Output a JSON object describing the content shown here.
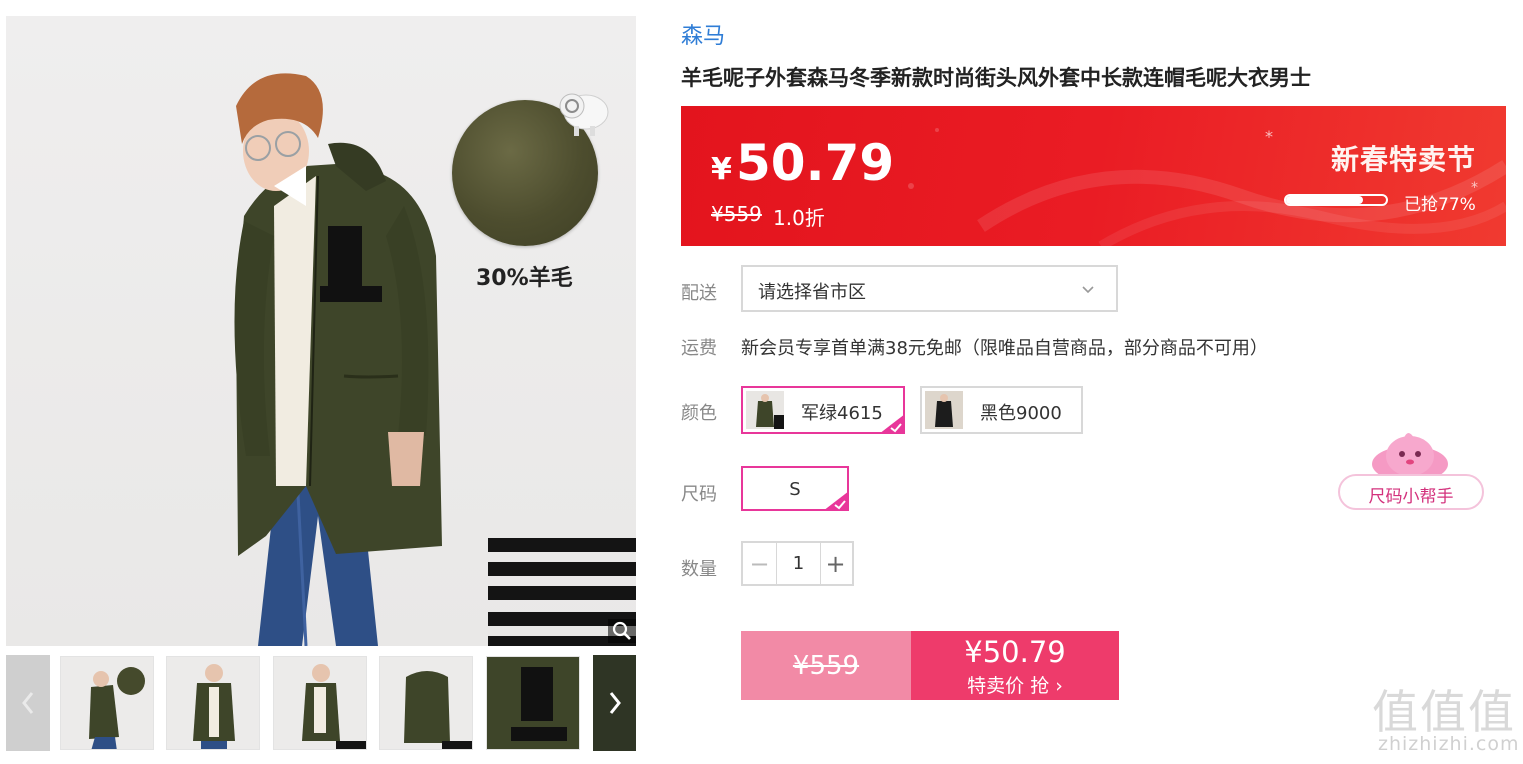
{
  "gallery": {
    "feature_label": "30%羊毛",
    "thumbnail_count": 5,
    "prev_arrow": "chevron-left-icon",
    "next_arrow": "chevron-right-icon",
    "zoom_icon": "magnifier-icon"
  },
  "product": {
    "brand": "森马",
    "title": "羊毛呢子外套森马冬季新款时尚街头风外套中长款连帽毛呢大衣男士"
  },
  "promo": {
    "currency": "¥",
    "price": "50.79",
    "original_price": "¥559",
    "discount": "1.0折",
    "festival": "新春特卖节",
    "sold_label": "已抢77%",
    "sold_fraction": 0.77
  },
  "labels": {
    "delivery": "配送",
    "shipping": "运费",
    "color": "颜色",
    "size": "尺码",
    "quantity": "数量"
  },
  "delivery": {
    "placeholder": "请选择省市区"
  },
  "shipping": {
    "text": "新会员专享首单满38元免邮（限唯品自营商品，部分商品不可用）"
  },
  "colors": [
    {
      "label": "军绿4615",
      "selected": true
    },
    {
      "label": "黑色9000",
      "selected": false
    }
  ],
  "sizes": [
    {
      "label": "S",
      "selected": true
    }
  ],
  "size_helper": {
    "label": "尺码小帮手"
  },
  "quantity": {
    "minus": "−",
    "value": "1",
    "plus": "+"
  },
  "buy": {
    "original_price": "¥559",
    "price": "¥50.79",
    "action": "特卖价 抢 ›"
  },
  "colors_theme": {
    "accent_pink": "#e8369a",
    "buy_pink": "#ee3b6b",
    "promo_red": "#e3141d",
    "brand_blue": "#2f7dd6"
  }
}
